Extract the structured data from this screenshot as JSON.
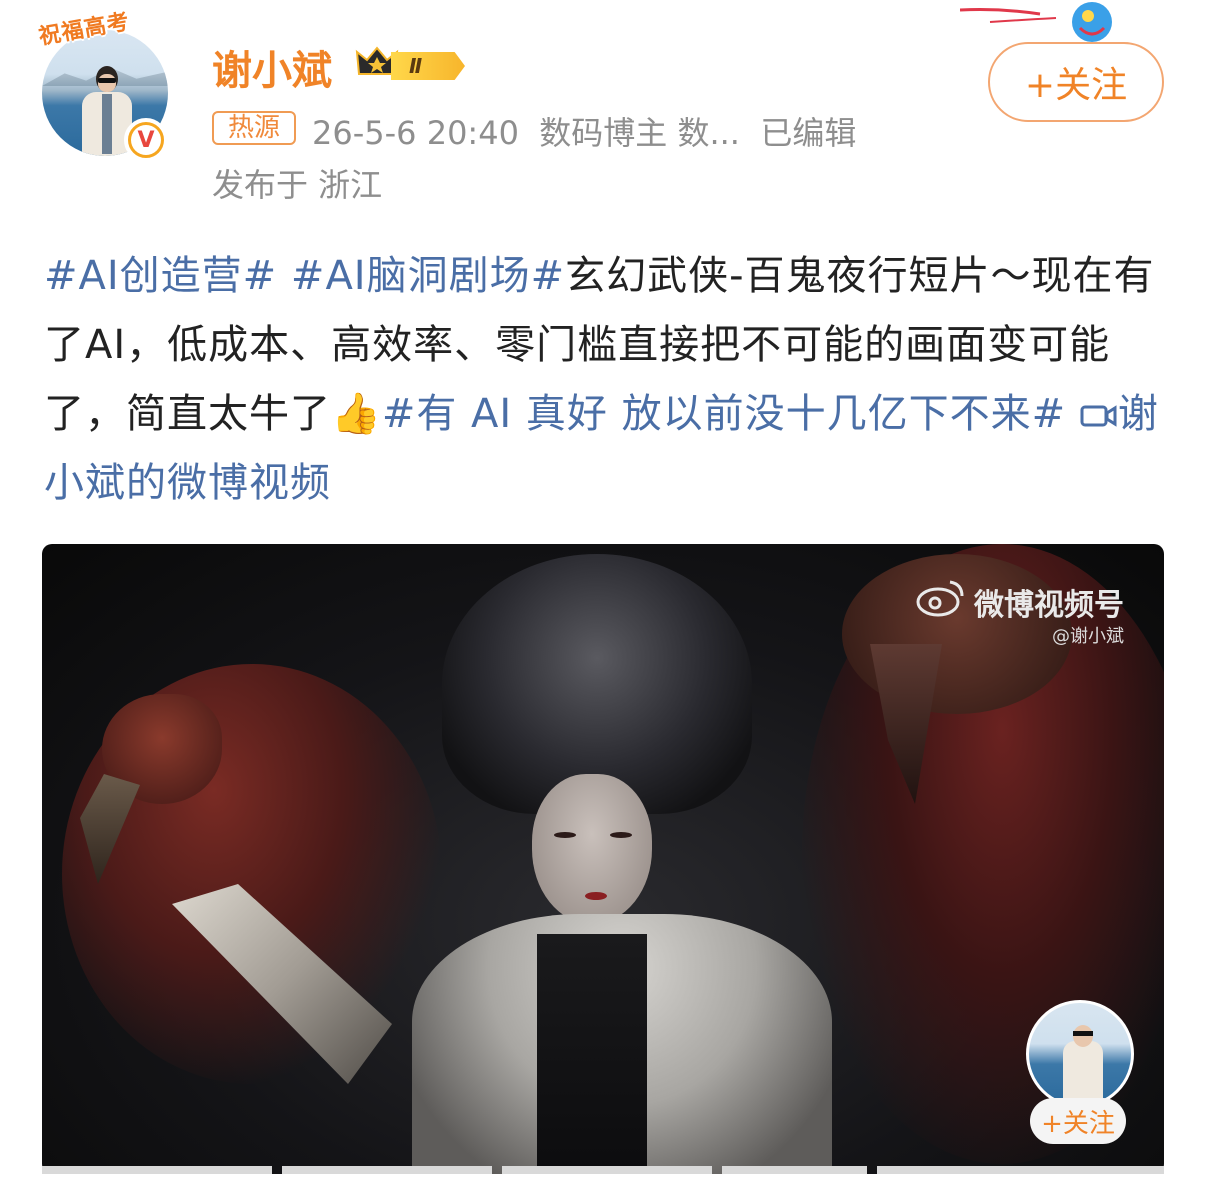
{
  "header": {
    "hat_text": "祝福高考",
    "username": "谢小斌",
    "badge_level": "Ⅱ",
    "hot_tag": "热源",
    "timestamp": "26-5-6 20:40",
    "category": "数码博主 数...",
    "edited": "已编辑",
    "location": "发布于 浙江",
    "follow_label": "+关注"
  },
  "post": {
    "tag1": "#AI创造营#",
    "tag2": "#AI脑洞剧场#",
    "text1": "玄幻武侠-百鬼夜行短片～现在有了AI，低成本、高效率、零门槛直接把不可能的画面变可能了，简直太牛了",
    "emoji": "👍",
    "tag3": "#有 AI 真好 放以前没十几亿下不来#",
    "video_link": "谢小斌的微博视频"
  },
  "video": {
    "watermark_title": "微博视频号",
    "watermark_user": "@谢小斌",
    "mini_follow_label": "+关注"
  },
  "colors": {
    "accent": "#f08327",
    "hashtag": "#4a6ea6",
    "meta": "#8e8e8e"
  }
}
